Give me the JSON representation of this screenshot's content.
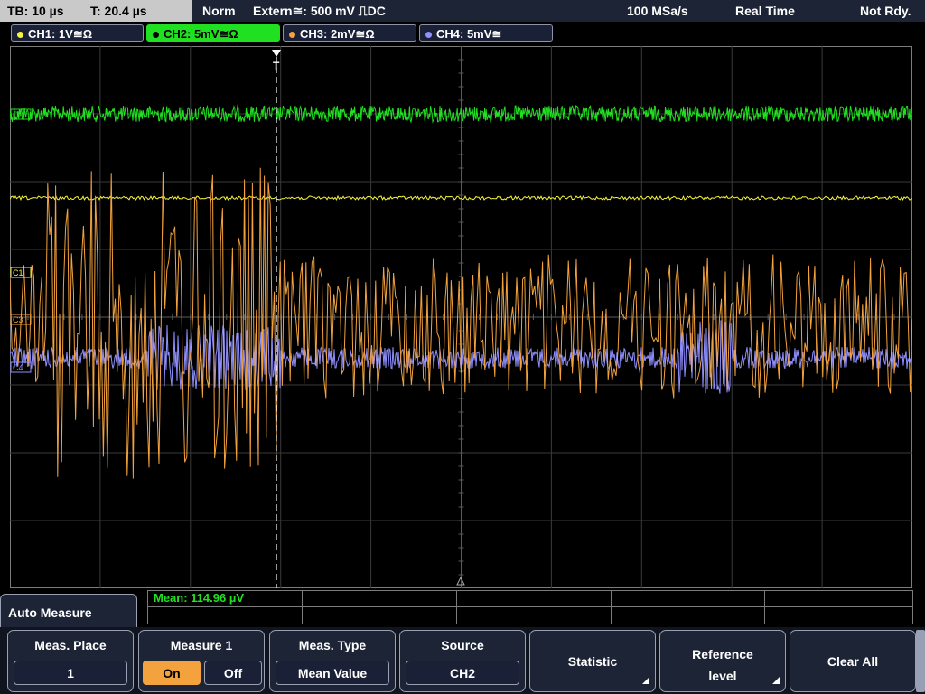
{
  "status": {
    "timebase": "TB: 10 µs",
    "trigger_time": "T: 20.4 µs",
    "acq_mode": "Norm",
    "trigger": "Extern≅: 500 mV ⎍DC",
    "sample_rate": "100 MSa/s",
    "mode": "Real Time",
    "trigger_state": "Not Rdy."
  },
  "channels": [
    {
      "label": "CH1: 1V≅Ω",
      "color": "#f5f53a",
      "active": false
    },
    {
      "label": "CH2: 5mV≅Ω",
      "color": "#21e021",
      "active": true
    },
    {
      "label": "CH3: 2mV≅Ω",
      "color": "#f3a23d",
      "active": false
    },
    {
      "label": "CH4: 5mV≅",
      "color": "#8f8fff",
      "active": false
    }
  ],
  "markers": {
    "ch1": "C1",
    "ch2": "C2",
    "ch3": "C3",
    "ch4": "C4",
    "trigger": "T"
  },
  "measurement": {
    "result": "Mean: 114.96 µV"
  },
  "menu": {
    "title": "Auto Measure",
    "softkeys": {
      "meas_place": {
        "label": "Meas. Place",
        "value": "1"
      },
      "measure1": {
        "label": "Measure 1",
        "on": "On",
        "off": "Off",
        "state": "On"
      },
      "meas_type": {
        "label": "Meas. Type",
        "value": "Mean Value"
      },
      "source": {
        "label": "Source",
        "value": "CH2"
      },
      "statistic": {
        "label": "Statistic"
      },
      "reference_level": {
        "label_line1": "Reference",
        "label_line2": "level"
      },
      "clear_all": {
        "label": "Clear All"
      }
    }
  },
  "colors": {
    "ch1": "#f5f53a",
    "ch2": "#21e021",
    "ch3": "#f3a23d",
    "ch4": "#8f8fff",
    "grid": "#4a4a4a",
    "panel": "#1d2436"
  }
}
